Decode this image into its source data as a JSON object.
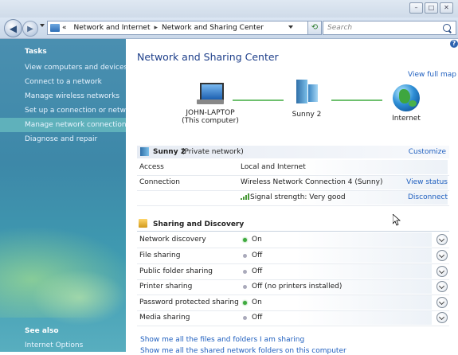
{
  "titlebar": {
    "buttons": [
      "–",
      "□",
      "✕"
    ]
  },
  "address": {
    "segments": [
      "«",
      "Network and Internet",
      "Network and Sharing Center"
    ],
    "search_placeholder": "Search"
  },
  "sidebar": {
    "heading": "Tasks",
    "items": [
      {
        "label": "View computers and devices"
      },
      {
        "label": "Connect to a network"
      },
      {
        "label": "Manage wireless networks"
      },
      {
        "label": "Set up a connection or network"
      },
      {
        "label": "Manage network connections"
      },
      {
        "label": "Diagnose and repair"
      }
    ],
    "see_also": "See also",
    "internet_options": "Internet Options"
  },
  "main": {
    "title": "Network and Sharing Center",
    "view_full_map": "View full map",
    "map": {
      "computer_name": "JOHN-LAPTOP",
      "computer_sub": "(This computer)",
      "network_name": "Sunny  2",
      "internet": "Internet"
    },
    "network": {
      "name": "Sunny  2",
      "type": "(Private network)",
      "customize": "Customize",
      "rows": [
        {
          "label": "Access",
          "value": "Local and Internet",
          "link": ""
        },
        {
          "label": "Connection",
          "value": "Wireless Network Connection 4 (Sunny)",
          "link": "View status"
        },
        {
          "label": "",
          "value": "Signal strength:  Very good",
          "link": "Disconnect"
        }
      ]
    },
    "sharing": {
      "title": "Sharing and Discovery",
      "rows": [
        {
          "label": "Network discovery",
          "value": "On",
          "on": true
        },
        {
          "label": "File sharing",
          "value": "Off",
          "on": false
        },
        {
          "label": "Public folder sharing",
          "value": "Off",
          "on": false
        },
        {
          "label": "Printer sharing",
          "value": "Off (no printers installed)",
          "on": false
        },
        {
          "label": "Password protected sharing",
          "value": "On",
          "on": true
        },
        {
          "label": "Media sharing",
          "value": "Off",
          "on": false
        }
      ]
    },
    "links": [
      "Show me all the files and folders I am sharing",
      "Show me all the shared network folders on this computer"
    ]
  }
}
